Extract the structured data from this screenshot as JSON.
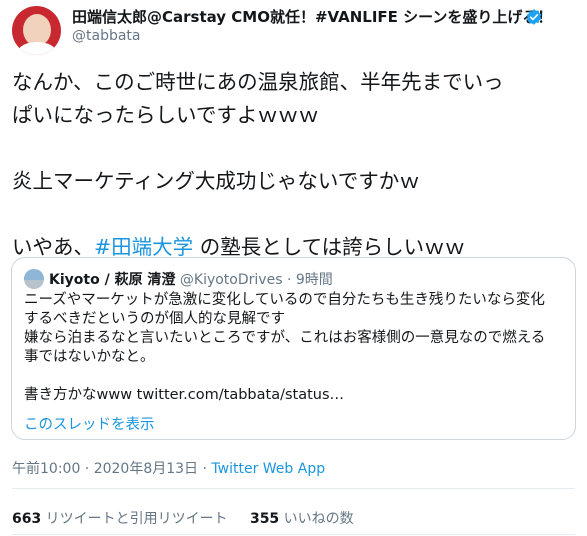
{
  "author": {
    "display_name": "田端信太郎@Carstay CMO就任！#VANLIFE シーンを盛り上げる！",
    "handle": "@tabbata",
    "verified_icon": "verified-badge-icon"
  },
  "tweet": {
    "line1": "なんか、このご時世にあの温泉旅館、半年先までいっ",
    "line2": "ぱいになったらしいですよｗｗｗ",
    "line3": "炎上マーケティング大成功じゃないですかｗ",
    "line4_prefix": "いやあ、",
    "line4_hashtag": "#田端大学",
    "line4_suffix": " の塾長としては誇らしいｗｗ"
  },
  "quote": {
    "name": "Kiyoto / 萩原 清澄",
    "handle": "@KiyotoDrives",
    "time": "· 9時間",
    "line1": "ニーズやマーケットが急激に変化しているので自分たちも生き残りたいなら変化",
    "line2": "するべきだというのが個人的な見解です",
    "line3": "嫌なら泊まるなと言いたいところですが、これはお客様側の一意見なので燃える",
    "line4": "事ではないかなと。",
    "line5": "書き方かなwww twitter.com/tabbata/status…",
    "thread_link": "このスレッドを表示"
  },
  "meta": {
    "timestamp": "午前10:00 · 2020年8月13日 · ",
    "source": "Twitter Web App"
  },
  "stats": {
    "retweets": "663",
    "retweets_label": " リツイートと引用リツイート",
    "likes": "355",
    "likes_label": " いいねの数"
  },
  "colors": {
    "link": "#1b95e0",
    "secondary_text": "#657786",
    "border": "#ccd6dd"
  }
}
